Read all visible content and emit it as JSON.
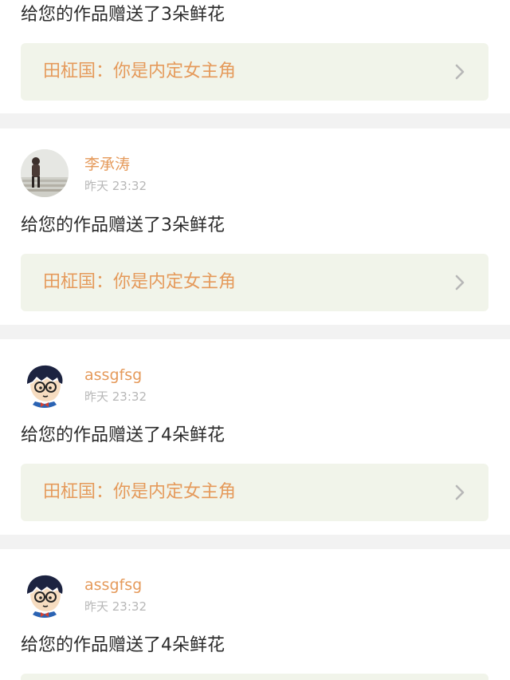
{
  "colors": {
    "accent": "#e59a5b",
    "work_bg": "#f1f4ea",
    "separator": "#f2f2f2",
    "time": "#b7b7b7"
  },
  "feed": {
    "items": [
      {
        "partial": "top",
        "message": "给您的作品赠送了3朵鲜花",
        "work_title": "田柾国：你是内定女主角",
        "chevron": "chevron-right-icon"
      },
      {
        "username": "李承涛",
        "time": "昨天 23:32",
        "avatar": "photo-avatar",
        "message": "给您的作品赠送了3朵鲜花",
        "work_title": "田柾国：你是内定女主角",
        "chevron": "chevron-right-icon"
      },
      {
        "username": "assgfsg",
        "time": "昨天 23:32",
        "avatar": "cartoon-avatar",
        "message": "给您的作品赠送了4朵鲜花",
        "work_title": "田柾国：你是内定女主角",
        "chevron": "chevron-right-icon"
      },
      {
        "partial": "bottom",
        "username": "assgfsg",
        "time": "昨天 23:32",
        "avatar": "cartoon-avatar",
        "message": "给您的作品赠送了4朵鲜花",
        "work_title": "",
        "chevron": "chevron-right-icon"
      }
    ]
  }
}
